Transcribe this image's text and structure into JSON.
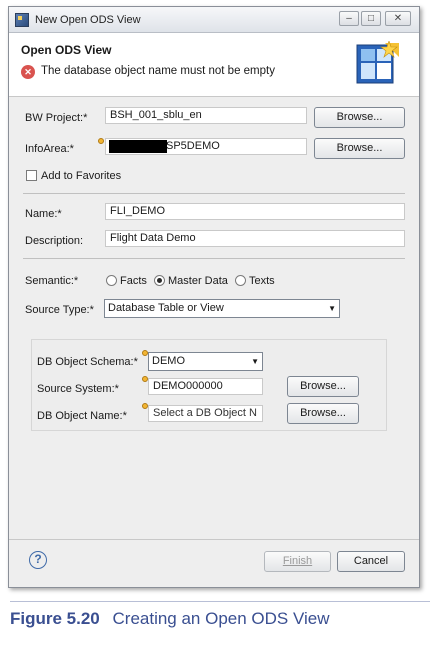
{
  "window": {
    "title": "New Open ODS View",
    "controls": [
      "–",
      "□",
      "✕"
    ]
  },
  "header": {
    "title": "Open ODS View",
    "error_icon": "x-circle-icon",
    "error_message": "The database object name must not be empty",
    "wizard_icon": "ods-wizard-icon"
  },
  "form": {
    "bw_project": {
      "label": "BW Project:*",
      "value": "BSH_001_sblu_en",
      "browse": "Browse..."
    },
    "infoarea": {
      "label": "InfoArea:*",
      "value": "SP5DEMO",
      "browse": "Browse..."
    },
    "add_to_favorites": {
      "label": "Add to Favorites",
      "checked": false
    },
    "name": {
      "label": "Name:*",
      "value": "FLI_DEMO"
    },
    "description": {
      "label": "Description:",
      "value": "Flight Data Demo"
    },
    "semantic": {
      "label": "Semantic:*",
      "options": [
        "Facts",
        "Master Data",
        "Texts"
      ],
      "selected": "Master Data"
    },
    "source_type": {
      "label": "Source Type:*",
      "value": "Database Table or View"
    }
  },
  "db": {
    "schema": {
      "label": "DB Object Schema:*",
      "value": "DEMO"
    },
    "source_system": {
      "label": "Source System:*",
      "value": "DEMO000000",
      "browse": "Browse..."
    },
    "object_name": {
      "label": "DB Object Name:*",
      "placeholder": "Select a DB Object N",
      "browse": "Browse..."
    }
  },
  "footer": {
    "help": "?",
    "finish": "Finish",
    "cancel": "Cancel"
  },
  "caption": {
    "figure": "Figure 5.20",
    "text": "Creating an Open ODS View"
  }
}
